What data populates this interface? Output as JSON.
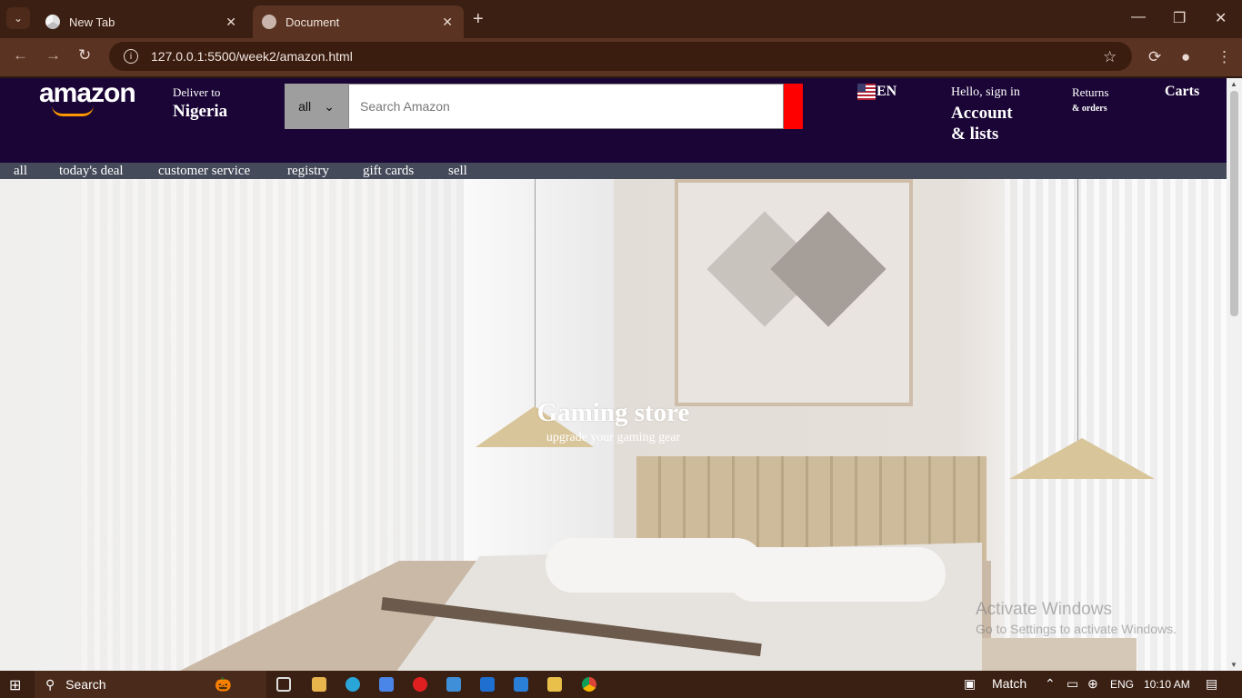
{
  "browser": {
    "tabs": [
      {
        "label": "New Tab",
        "active": false
      },
      {
        "label": "Document",
        "active": true
      }
    ],
    "url": "127.0.0.1:5500/week2/amazon.html"
  },
  "header": {
    "logo": "amazon",
    "deliver_label": "Deliver to",
    "deliver_location": "Nigeria",
    "search_category": "all",
    "search_placeholder": "Search Amazon",
    "language": "EN",
    "account_greeting": "Hello, sign in",
    "account_label": "Account & lists",
    "returns_label": "Returns",
    "orders_label": "& orders",
    "carts_label": "Carts"
  },
  "subnav": {
    "items": [
      "all",
      "today's deal",
      "customer service",
      "registry",
      "gift cards",
      "sell"
    ]
  },
  "hero": {
    "title": "Gaming store",
    "subtitle": "upgrade your gaming gear"
  },
  "watermark": {
    "line1": "Activate Windows",
    "line2": "Go to Settings to activate Windows."
  },
  "taskbar": {
    "search_label": "Search",
    "weather_label": "Match",
    "language": "ENG",
    "time": "10:10 AM"
  },
  "colors": {
    "header_bg": "#1a0536",
    "subnav_bg": "#454a5a",
    "search_button": "#ff0000",
    "browser_frame": "#3a1f12"
  }
}
